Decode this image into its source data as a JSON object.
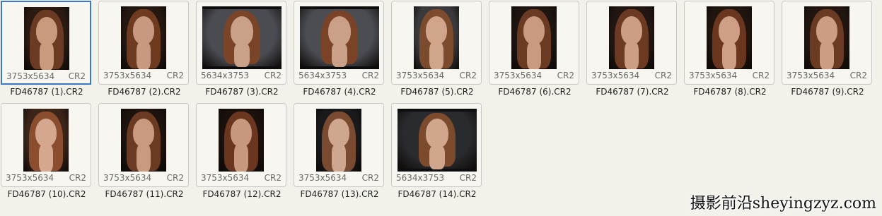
{
  "files": [
    {
      "name": "FD46787 (1).CR2",
      "dims": "3753x5634",
      "type": "CR2",
      "orientation": "portrait",
      "selected": true,
      "bg": "#2a1a12",
      "hair": "#6b3a22",
      "skin": "#c99a7e"
    },
    {
      "name": "FD46787 (2).CR2",
      "dims": "3753x5634",
      "type": "CR2",
      "orientation": "portrait",
      "selected": false,
      "bg": "#241710",
      "hair": "#6e3b20",
      "skin": "#c89880"
    },
    {
      "name": "FD46787 (3).CR2",
      "dims": "5634x3753",
      "type": "CR2",
      "orientation": "landscape",
      "selected": false,
      "bg": "#4a4c52",
      "hair": "#7a4428",
      "skin": "#c9a088"
    },
    {
      "name": "FD46787 (4).CR2",
      "dims": "5634x3753",
      "type": "CR2",
      "orientation": "landscape",
      "selected": false,
      "bg": "#4b4d53",
      "hair": "#7a4226",
      "skin": "#caa088"
    },
    {
      "name": "FD46787 (5).CR2",
      "dims": "3753x5634",
      "type": "CR2",
      "orientation": "portrait",
      "selected": false,
      "bg": "#3a3a3c",
      "hair": "#7c4a2c",
      "skin": "#d0a58c"
    },
    {
      "name": "FD46787 (6).CR2",
      "dims": "3753x5634",
      "type": "CR2",
      "orientation": "portrait",
      "selected": false,
      "bg": "#1e1410",
      "hair": "#6a3a22",
      "skin": "#c99a80"
    },
    {
      "name": "FD46787 (7).CR2",
      "dims": "3753x5634",
      "type": "CR2",
      "orientation": "portrait",
      "selected": false,
      "bg": "#221612",
      "hair": "#6c3a22",
      "skin": "#cc9e84"
    },
    {
      "name": "FD46787 (8).CR2",
      "dims": "3753x5634",
      "type": "CR2",
      "orientation": "portrait",
      "selected": false,
      "bg": "#20140f",
      "hair": "#6a3620",
      "skin": "#cf9e86"
    },
    {
      "name": "FD46787 (9).CR2",
      "dims": "3753x5634",
      "type": "CR2",
      "orientation": "portrait",
      "selected": false,
      "bg": "#221510",
      "hair": "#6a3a22",
      "skin": "#cc9c84"
    },
    {
      "name": "FD46787 (10).CR2",
      "dims": "3753x5634",
      "type": "CR2",
      "orientation": "portrait",
      "selected": false,
      "bg": "#3b2418",
      "hair": "#8a4e2e",
      "skin": "#d4a78e"
    },
    {
      "name": "FD46787 (11).CR2",
      "dims": "3753x5634",
      "type": "CR2",
      "orientation": "portrait",
      "selected": false,
      "bg": "#1d120d",
      "hair": "#6a3a22",
      "skin": "#c99a80"
    },
    {
      "name": "FD46787 (12).CR2",
      "dims": "3753x5634",
      "type": "CR2",
      "orientation": "portrait",
      "selected": false,
      "bg": "#1a100c",
      "hair": "#6a3620",
      "skin": "#c8987e"
    },
    {
      "name": "FD46787 (13).CR2",
      "dims": "3753x5634",
      "type": "CR2",
      "orientation": "portrait",
      "selected": false,
      "bg": "#1a1a1c",
      "hair": "#7a4a30",
      "skin": "#cfa68e"
    },
    {
      "name": "FD46787 (14).CR2",
      "dims": "5634x3753",
      "type": "CR2",
      "orientation": "landscape",
      "selected": false,
      "bg": "#2a2b2e",
      "hair": "#7c4a2c",
      "skin": "#d0a68c"
    }
  ],
  "watermark": "摄影前沿sheyingzyz.com",
  "selection_color": "#3c78c8"
}
